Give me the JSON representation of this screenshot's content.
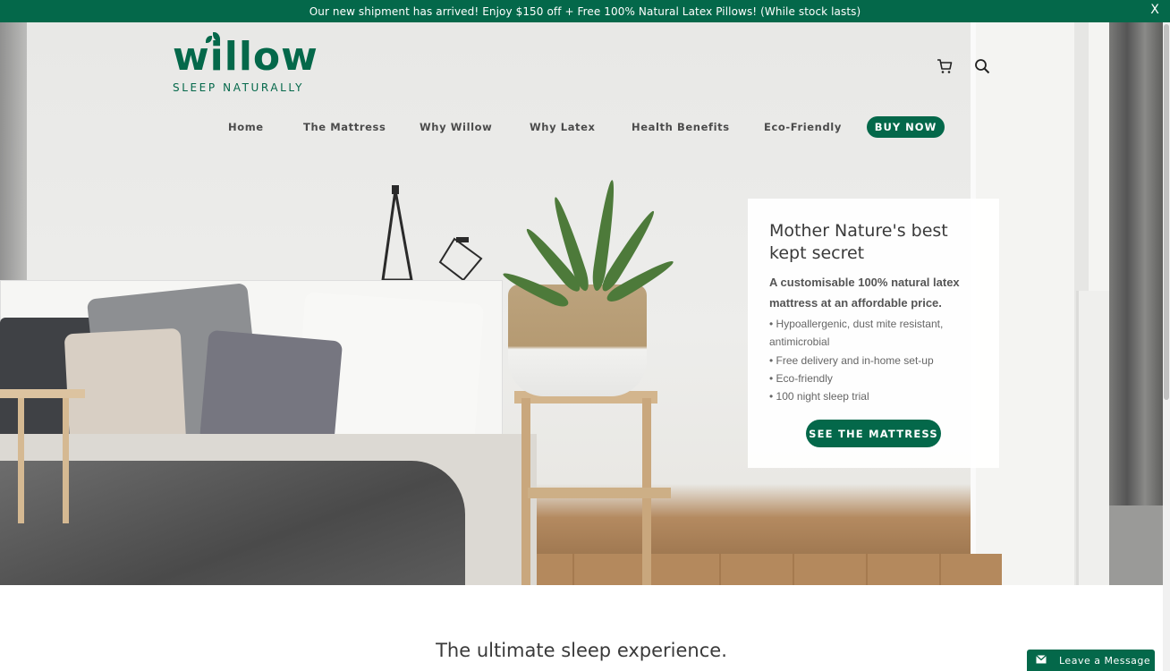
{
  "announcement": {
    "text": "Our new shipment has arrived! Enjoy $150 off + Free 100% Natural Latex Pillows! (While stock lasts)",
    "close_label": "X"
  },
  "brand": {
    "name": "willow",
    "tagline": "SLEEP NATURALLY",
    "color": "#04684a"
  },
  "header": {
    "icons": [
      "cart-icon",
      "search-icon"
    ]
  },
  "nav": {
    "items": [
      {
        "label": "Home"
      },
      {
        "label": "The Mattress"
      },
      {
        "label": "Why Willow"
      },
      {
        "label": "Why Latex"
      },
      {
        "label": "Health Benefits"
      },
      {
        "label": "Eco-Friendly"
      }
    ],
    "buy_now": "BUY NOW"
  },
  "hero": {
    "heading": "Mother Nature's best kept secret",
    "subheading": "A customisable 100% natural latex mattress at an affordable price.",
    "bullets": [
      "• Hypoallergenic, dust mite resistant, antimicrobial",
      "• Free delivery and in-home set-up",
      "• Eco-friendly",
      "• 100 night sleep trial"
    ],
    "cta": "SEE THE MATTRESS"
  },
  "section": {
    "title": "The ultimate sleep experience."
  },
  "chat": {
    "label": "Leave a Message",
    "icon": "envelope-icon"
  }
}
